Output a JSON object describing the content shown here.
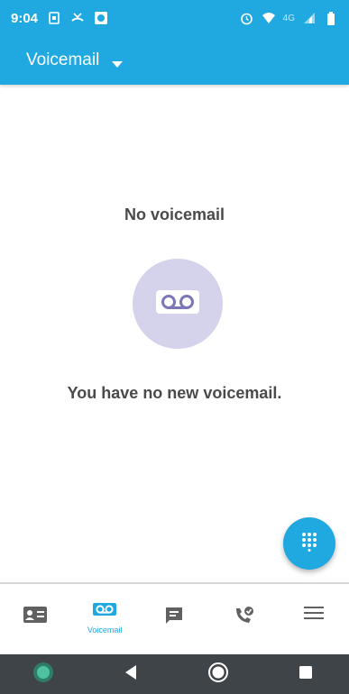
{
  "status_bar": {
    "time": "9:04",
    "network": "4G",
    "icons": [
      "sim-icon",
      "missed-call-icon",
      "app-notification-icon",
      "alarm-icon",
      "wifi-icon",
      "signal-icon",
      "battery-icon"
    ]
  },
  "app_bar": {
    "title": "Voicemail",
    "icon": "dropdown-arrow-icon"
  },
  "empty_state": {
    "title": "No voicemail",
    "message": "You have no new voicemail.",
    "icon": "voicemail-icon"
  },
  "fab": {
    "icon": "dialpad-icon"
  },
  "bottom_nav": {
    "items": [
      {
        "icon": "contacts-card-icon",
        "label": ""
      },
      {
        "icon": "voicemail-icon",
        "label": "Voicemail",
        "active": true
      },
      {
        "icon": "message-icon",
        "label": ""
      },
      {
        "icon": "call-log-icon",
        "label": ""
      },
      {
        "icon": "menu-icon",
        "label": ""
      }
    ]
  },
  "android_nav": {
    "buttons": [
      "assistant-icon",
      "back-icon",
      "home-icon",
      "recents-icon"
    ]
  },
  "colors": {
    "accent": "#20a8e0",
    "circle": "#d5d3ec",
    "icon_purple": "#7b76b8",
    "text": "#4a4a4a",
    "nav_icon": "#616161",
    "system_nav": "#3f4448"
  }
}
